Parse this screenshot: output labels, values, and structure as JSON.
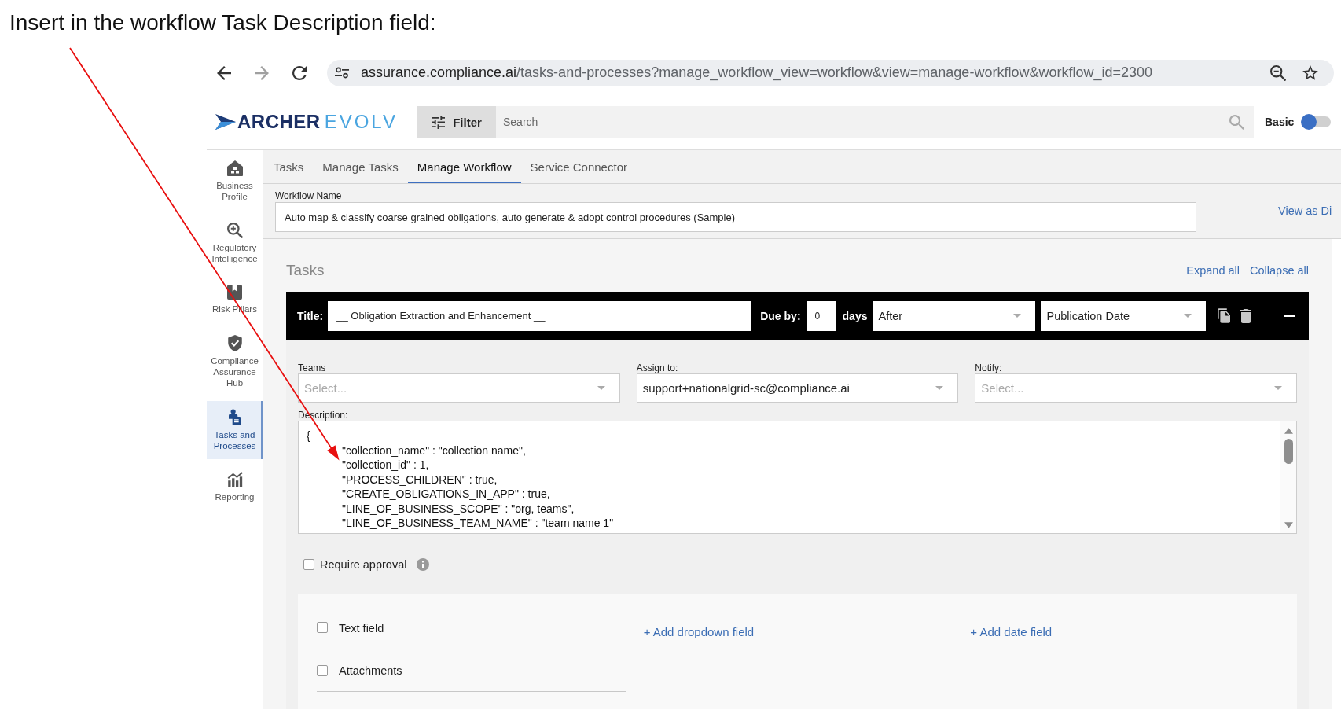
{
  "annotation": {
    "caption": "Insert in the workflow Task Description field:"
  },
  "browser": {
    "url_host": "assurance.compliance.ai",
    "url_path": "/tasks-and-processes?manage_workflow_view=workflow&view=manage-workflow&workflow_id=2300"
  },
  "header": {
    "logo": {
      "primary": "ARCHER",
      "secondary": "EVOLV"
    },
    "filter_button": "Filter",
    "search": {
      "placeholder": "Search"
    },
    "mode_toggle": {
      "label": "Basic",
      "on": false
    }
  },
  "sidebar": {
    "items": [
      {
        "kind": "house",
        "label": "Business Profile",
        "selected": false
      },
      {
        "kind": "magnifier",
        "label": "Regulatory Intelligence",
        "selected": false
      },
      {
        "kind": "bookmark",
        "label": "Risk Pillars",
        "selected": false
      },
      {
        "kind": "shield",
        "label": "Compliance Assurance Hub",
        "selected": false
      },
      {
        "kind": "person",
        "label": "Tasks and Processes",
        "selected": true
      },
      {
        "kind": "chart",
        "label": "Reporting",
        "selected": false
      }
    ]
  },
  "tabs": [
    {
      "label": "Tasks",
      "selected": false
    },
    {
      "label": "Manage Tasks",
      "selected": false
    },
    {
      "label": "Manage Workflow",
      "selected": true
    },
    {
      "label": "Service Connector",
      "selected": false
    }
  ],
  "workflow_name": {
    "label": "Workflow Name",
    "value": "Auto map & classify coarse grained obligations, auto generate & adopt control procedures (Sample)",
    "view_link": "View as Di"
  },
  "tasks": {
    "heading": "Tasks",
    "expand_all": "Expand all",
    "collapse_all": "Collapse all",
    "task": {
      "title_label": "Title:",
      "title": "__ Obligation Extraction and Enhancement __",
      "due_label": "Due by:",
      "due_value": "0",
      "due_unit": "days",
      "relation": "After",
      "anchor": "Publication Date",
      "assignment_fields": [
        {
          "label": "Teams",
          "placeholder": "Select..."
        },
        {
          "label": "Assign to:",
          "value": "support+nationalgrid-sc@compliance.ai"
        },
        {
          "label": "Notify:",
          "placeholder": "Select..."
        }
      ],
      "description": {
        "label": "Description:",
        "value": "{\n\t\"collection_name\" : \"collection name\",\n\t\"collection_id\" : 1,\n\t\"PROCESS_CHILDREN\" : true,\n\t\"CREATE_OBLIGATIONS_IN_APP\" : true,\n\t\"LINE_OF_BUSINESS_SCOPE\" : \"org, teams\",\n\t\"LINE_OF_BUSINESS_TEAM_NAME\" : \"team name 1\""
      },
      "require_approval": {
        "label": "Require approval",
        "checked": false
      },
      "custom_fields": {
        "options": [
          {
            "label": "Text field",
            "checked": false
          },
          {
            "label": "Attachments",
            "checked": false
          }
        ],
        "links": [
          "+ Add dropdown field",
          "+ Add date field"
        ]
      }
    }
  }
}
